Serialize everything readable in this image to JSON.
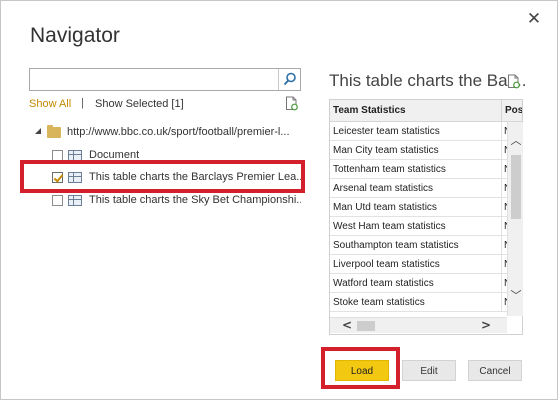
{
  "dialog": {
    "title": "Navigator",
    "close_glyph": "✕"
  },
  "search": {
    "value": "",
    "placeholder": "",
    "icon": "search-icon"
  },
  "filters": {
    "show_all": "Show All",
    "separator": "|",
    "show_selected": "Show Selected [1]"
  },
  "tree": {
    "root": {
      "label": "http://www.bbc.co.uk/sport/football/premier-l...",
      "icon": "folder-icon",
      "expanded": true
    },
    "items": [
      {
        "label": "Document",
        "checked": false,
        "icon": "table-icon"
      },
      {
        "label": "This table charts the Barclays Premier Lea...",
        "checked": true,
        "icon": "table-icon"
      },
      {
        "label": "This table charts the Sky Bet Championshi...",
        "checked": false,
        "icon": "table-icon"
      }
    ]
  },
  "preview": {
    "title": "This table charts the Bar...",
    "columns": [
      "Team Statistics",
      "Posi"
    ],
    "rows": [
      [
        "Leicester team statistics",
        "N"
      ],
      [
        "Man City team statistics",
        "N"
      ],
      [
        "Tottenham team statistics",
        "N"
      ],
      [
        "Arsenal team statistics",
        "N"
      ],
      [
        "Man Utd team statistics",
        "N"
      ],
      [
        "West Ham team statistics",
        "N"
      ],
      [
        "Southampton team statistics",
        "N"
      ],
      [
        "Liverpool team statistics",
        "N"
      ],
      [
        "Watford team statistics",
        "N"
      ],
      [
        "Stoke team statistics",
        "N"
      ]
    ]
  },
  "buttons": {
    "load": "Load",
    "edit": "Edit",
    "cancel": "Cancel"
  },
  "colors": {
    "accent": "#f2c811",
    "highlight": "#d4202a",
    "link": "#c48a00"
  }
}
